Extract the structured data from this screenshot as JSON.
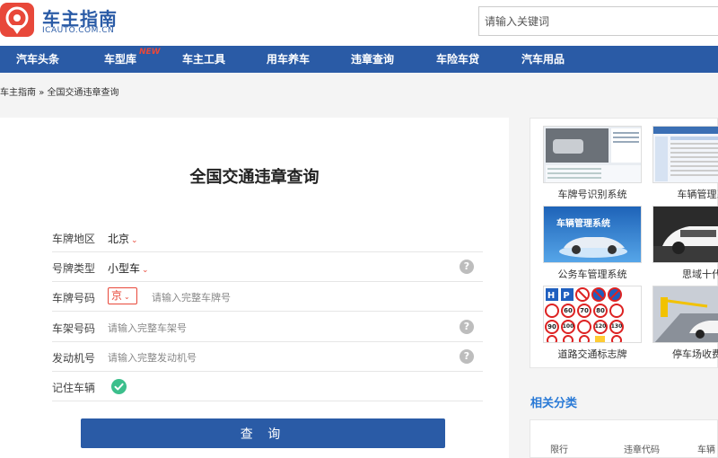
{
  "header": {
    "logo_name": "车主指南",
    "logo_domain": "ICAUTO.COM.CN",
    "search_placeholder": "请输入关键词"
  },
  "nav": {
    "items": [
      "汽车头条",
      "车型库",
      "车主工具",
      "用车养车",
      "违章查询",
      "车险车贷",
      "汽车用品"
    ],
    "new_badge": "NEW"
  },
  "breadcrumb": {
    "home": "车主指南",
    "separator": "»",
    "current": "全国交通违章查询"
  },
  "form": {
    "title": "全国交通违章查询",
    "region": {
      "label": "车牌地区",
      "value": "北京"
    },
    "plate_type": {
      "label": "号牌类型",
      "value": "小型车"
    },
    "plate_number": {
      "label": "车牌号码",
      "province": "京",
      "placeholder": "请输入完整车牌号"
    },
    "frame_number": {
      "label": "车架号码",
      "placeholder": "请输入完整车架号"
    },
    "engine_number": {
      "label": "发动机号",
      "placeholder": "请输入完整发动机号"
    },
    "remember": {
      "label": "记住车辆",
      "checked": true
    },
    "submit_label": "查 询",
    "help_glyph": "?",
    "caret_glyph": "⌄"
  },
  "sidebar": {
    "items": [
      {
        "caption": "车牌号识别系统"
      },
      {
        "caption": "车辆管理系"
      },
      {
        "caption": "公务车管理系统",
        "image_text": "车辆管理系统"
      },
      {
        "caption": "思域十代"
      },
      {
        "caption": "道路交通标志牌",
        "signs": [
          "60",
          "70",
          "80",
          "90",
          "100",
          "120",
          "130"
        ]
      },
      {
        "caption": "停车场收费系"
      }
    ],
    "related_title": "相关分类",
    "related_items": [
      "限行",
      "违章代码",
      "车辆"
    ]
  },
  "colors": {
    "brand_blue": "#2a5ba6",
    "brand_red": "#e8483a",
    "check_green": "#3cbf8c",
    "related_title": "#2a7ad6"
  }
}
